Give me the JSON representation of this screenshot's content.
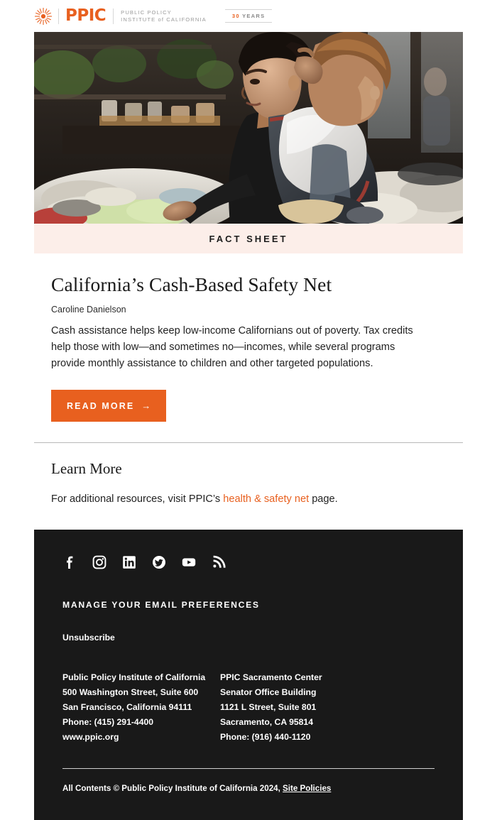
{
  "header": {
    "logo_word": "PPIC",
    "institute_line1": "PUBLIC POLICY",
    "institute_line2_a": "INSTITUTE",
    "institute_line2_of": "of",
    "institute_line2_b": "CALIFORNIA",
    "years_number": "30",
    "years_label": "YEARS"
  },
  "hero": {
    "alt": "Woman carrying a baby in a sling while shopping for clothes at a market stall"
  },
  "band": {
    "label": "FACT SHEET"
  },
  "article": {
    "title": "California’s Cash-Based Safety Net",
    "author": "Caroline Danielson",
    "description": "Cash assistance helps keep low-income Californians out of poverty. Tax credits help those with low—and sometimes no—incomes, while several programs provide monthly assistance to children and other targeted populations.",
    "read_more_label": "READ MORE",
    "read_more_arrow": "→"
  },
  "learn_more": {
    "title": "Learn More",
    "text_before": "For additional resources, visit PPIC’s ",
    "link_text": "health & safety net",
    "text_after": " page."
  },
  "footer": {
    "social": [
      {
        "name": "facebook-icon",
        "label": "Facebook"
      },
      {
        "name": "instagram-icon",
        "label": "Instagram"
      },
      {
        "name": "linkedin-icon",
        "label": "LinkedIn"
      },
      {
        "name": "twitter-icon",
        "label": "Twitter"
      },
      {
        "name": "youtube-icon",
        "label": "YouTube"
      },
      {
        "name": "rss-icon",
        "label": "RSS"
      }
    ],
    "manage_title": "MANAGE YOUR EMAIL PREFERENCES",
    "unsubscribe": "Unsubscribe",
    "address_left": [
      "Public Policy Institute of California",
      "500 Washington Street, Suite 600",
      "San Francisco, California 94111",
      "Phone: (415) 291-4400",
      "www.ppic.org"
    ],
    "address_right": [
      "PPIC Sacramento Center",
      "Senator Office Building",
      "1121 L Street, Suite 801",
      "Sacramento, CA 95814",
      "Phone: (916) 440-1120"
    ],
    "copyright_text": "All Contents © Public Policy Institute of California 2024, ",
    "copyright_link": "Site Policies"
  },
  "colors": {
    "brand_orange": "#E8601F",
    "band_pink": "#FCEEE9",
    "footer_dark": "#191919"
  }
}
